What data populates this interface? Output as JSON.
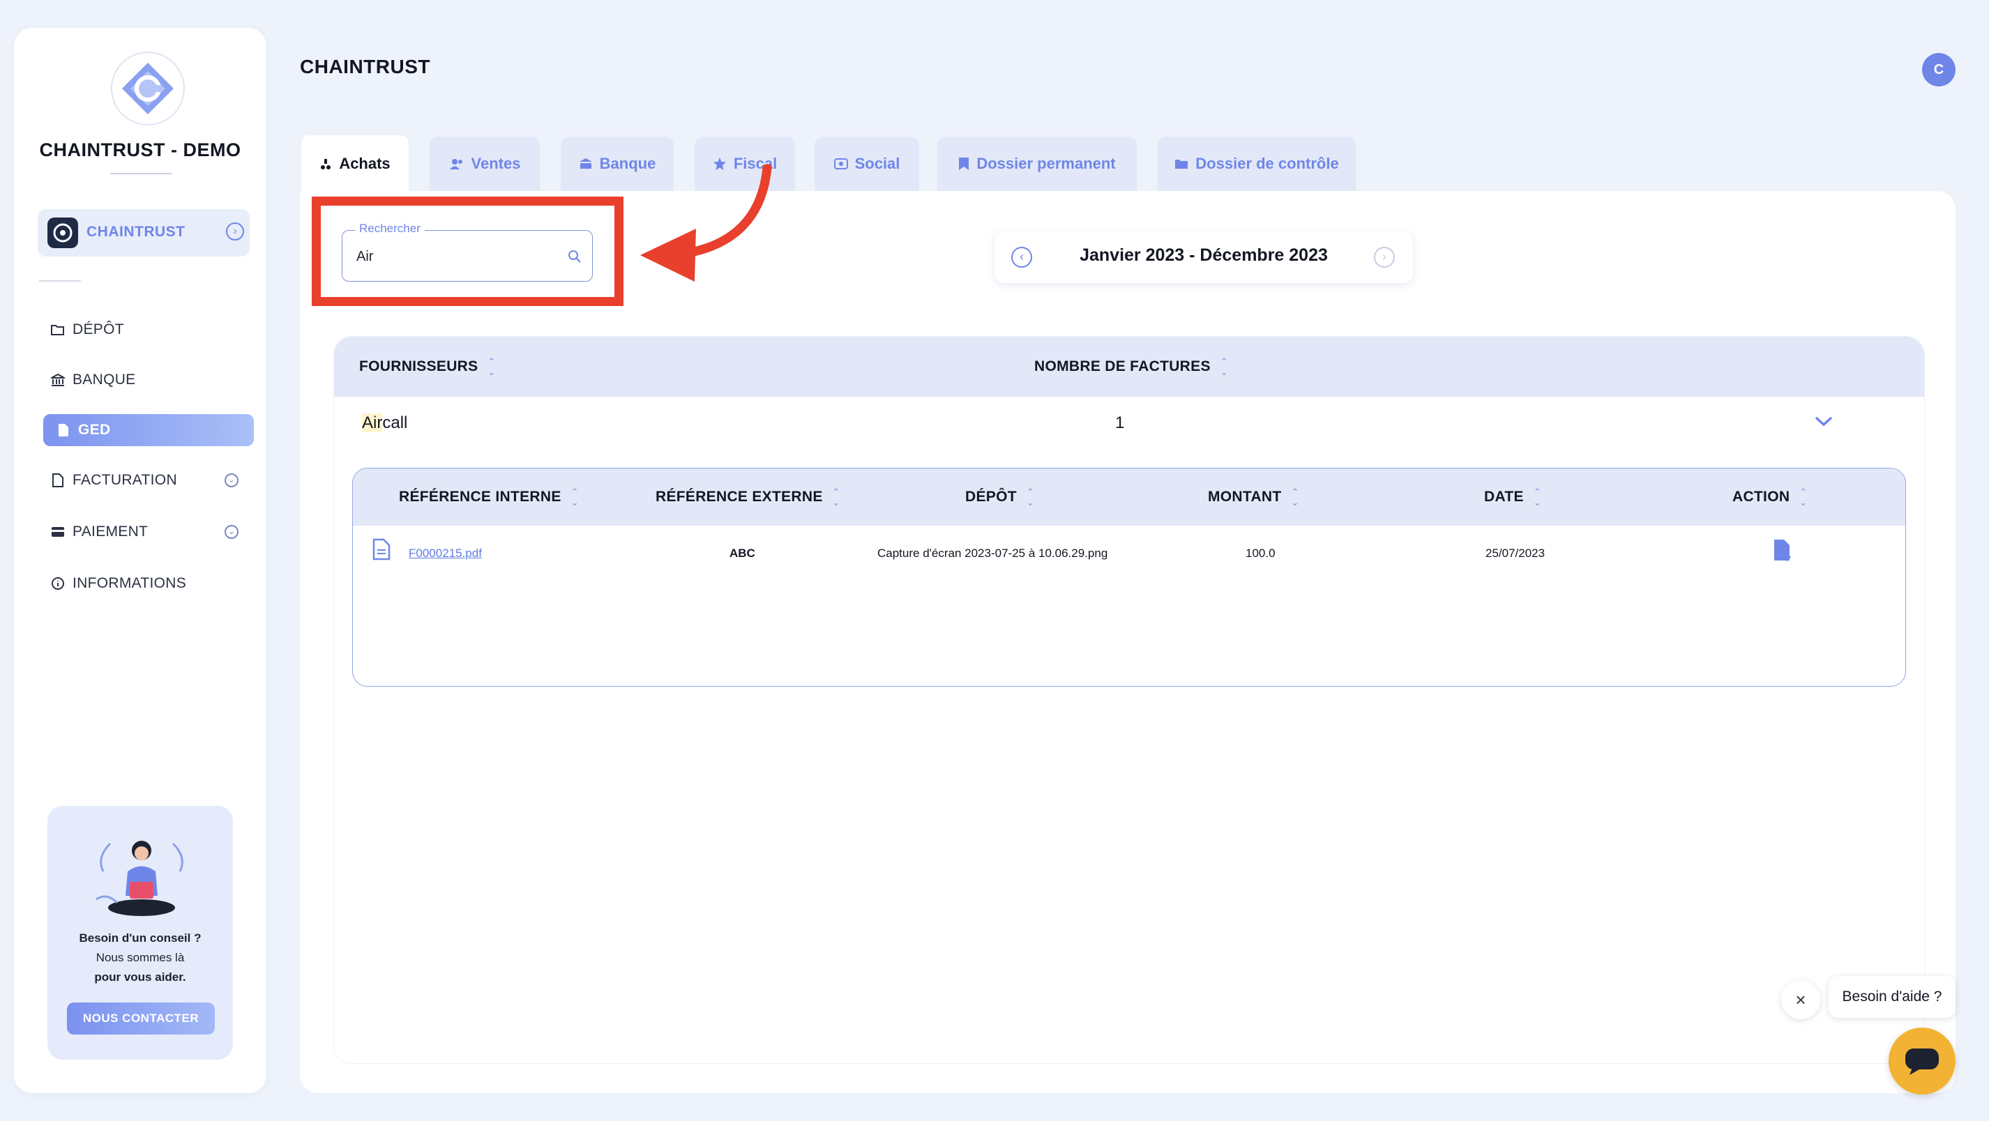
{
  "app_title": "CHAINTRUST",
  "avatar_initial": "C",
  "sidebar": {
    "company_name": "CHAINTRUST - DEMO",
    "account_label": "CHAINTRUST",
    "items": [
      {
        "label": "DÉPÔT",
        "icon": "folder-upload-icon"
      },
      {
        "label": "BANQUE",
        "icon": "bank-icon"
      },
      {
        "label": "GED",
        "icon": "document-icon",
        "active": true
      },
      {
        "label": "FACTURATION",
        "icon": "invoice-icon"
      },
      {
        "label": "PAIEMENT",
        "icon": "card-icon"
      },
      {
        "label": "INFORMATIONS",
        "icon": "info-icon"
      }
    ],
    "help": {
      "line1": "Besoin d'un conseil ?",
      "line2": "Nous sommes là",
      "line3": "pour vous aider.",
      "button": "NOUS CONTACTER"
    }
  },
  "tabs": [
    {
      "label": "Achats",
      "icon": "cart-icon",
      "active": true
    },
    {
      "label": "Ventes",
      "icon": "users-icon"
    },
    {
      "label": "Banque",
      "icon": "bank-icon"
    },
    {
      "label": "Fiscal",
      "icon": "star-icon"
    },
    {
      "label": "Social",
      "icon": "social-icon"
    },
    {
      "label": "Dossier permanent",
      "icon": "bookmark-icon"
    },
    {
      "label": "Dossier de contrôle",
      "icon": "folder-icon"
    }
  ],
  "search": {
    "label": "Rechercher",
    "value": "Air"
  },
  "period": {
    "label": "Janvier 2023 - Décembre 2023"
  },
  "table": {
    "headers": {
      "supplier": "FOURNISSEURS",
      "count": "NOMBRE DE FACTURES"
    },
    "rows": [
      {
        "name_match": "Air",
        "name_rest": "call",
        "count": "1"
      }
    ],
    "sub_headers": {
      "internal_ref": "RÉFÉRENCE INTERNE",
      "external_ref": "RÉFÉRENCE EXTERNE",
      "deposit": "DÉPÔT",
      "amount": "MONTANT",
      "date": "DATE",
      "action": "ACTION"
    },
    "sub_rows": [
      {
        "internal_ref": "F0000215.pdf",
        "external_ref": "ABC",
        "deposit": "Capture d'écran 2023-07-25 à 10.06.29.png",
        "amount": "100.0",
        "date": "25/07/2023"
      }
    ]
  },
  "chat": {
    "bubble": "Besoin d'aide ?"
  },
  "colors": {
    "accent": "#6f86e8",
    "highlight": "#e8402c",
    "chat": "#f2b233"
  }
}
